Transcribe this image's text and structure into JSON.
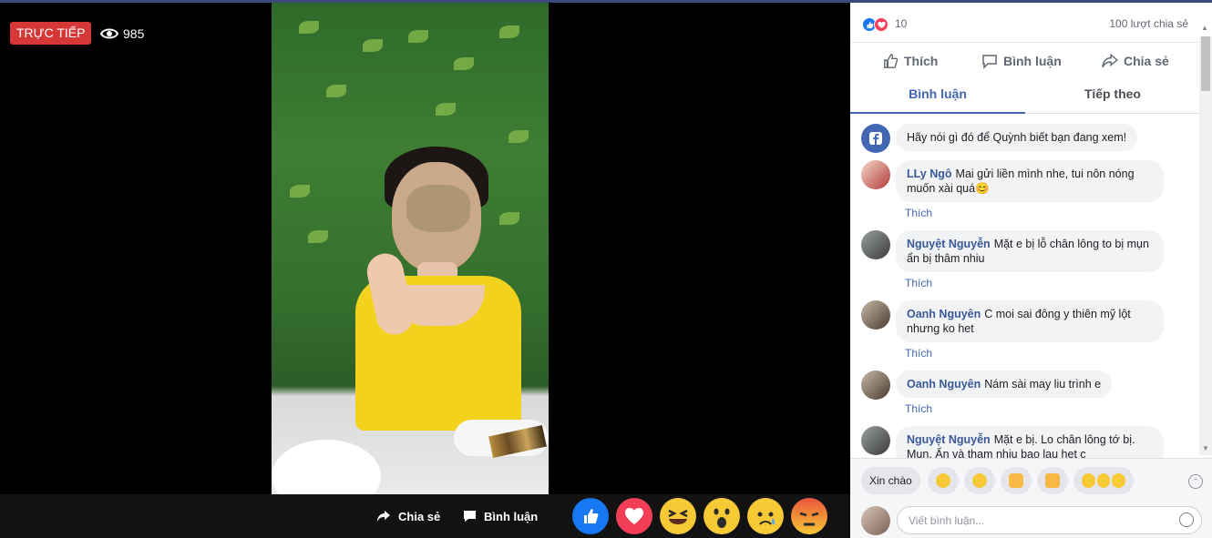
{
  "video": {
    "live_label": "TRỰC TIẾP",
    "viewer_count": "985",
    "actions": {
      "share": "Chia sẻ",
      "comment": "Bình luận"
    }
  },
  "panel": {
    "reaction_count": "10",
    "shares": "100 lượt chia sẻ",
    "actions": {
      "like": "Thích",
      "comment": "Bình luận",
      "share": "Chia sẻ"
    },
    "tabs": [
      "Bình luận",
      "Tiếp theo"
    ],
    "prompt": "Hãy nói gì đó để Quỳnh biết bạn đang xem!",
    "comments": [
      {
        "author": "LLy Ngô",
        "text": "Mai gửi liền mình nhe, tui nôn nóng muốn xài quá😊",
        "like": "Thích"
      },
      {
        "author": "Nguyệt Nguyễn",
        "text": "Mặt e bị lỗ chân lông to bị mụn ẩn bị thâm nhiu",
        "like": "Thích"
      },
      {
        "author": "Oanh Nguyên",
        "text": "C moi sai đông y thiên mỹ lột nhưng ko het",
        "like": "Thích"
      },
      {
        "author": "Oanh Nguyên",
        "text": "Nám sài may liu trình e",
        "like": "Thích"
      },
      {
        "author": "Nguyệt Nguyễn",
        "text": "Mặt e bị. Lo chân lông tớ bị. Mụn. Ẩn và tham nhiu bao lau het c",
        "like": ""
      }
    ],
    "quick_replies": [
      "Xin chào"
    ],
    "composer_placeholder": "Viết bình luận..."
  },
  "colors": {
    "accent": "#4267b2",
    "live": "#d63737",
    "like_blue": "#1877f2",
    "love_red": "#f33e58",
    "emoji_yellow": "#f7c934"
  }
}
